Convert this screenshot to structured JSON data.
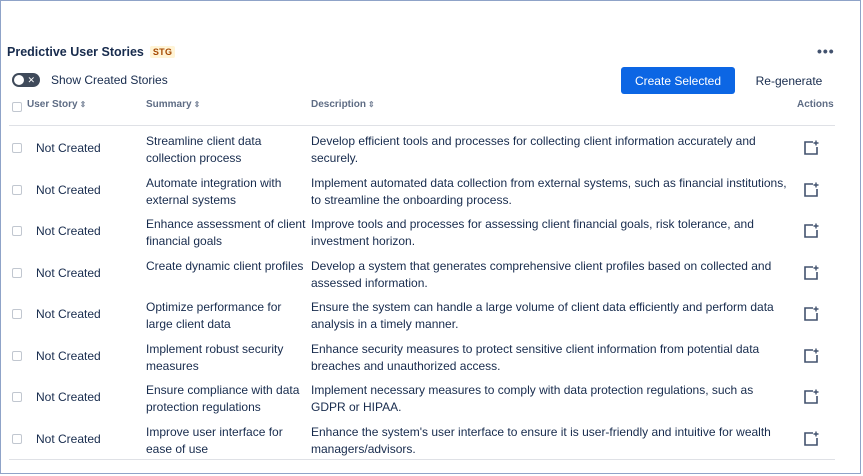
{
  "header": {
    "title": "Predictive User Stories",
    "badge": "STG",
    "more_icon": "more-horizontal-icon"
  },
  "toolbar": {
    "toggle_label": "Show Created Stories",
    "create_label": "Create Selected",
    "regenerate_label": "Re-generate",
    "toggle_on": false,
    "accent_color": "#0c66e4"
  },
  "table": {
    "headers": {
      "user_story": "User Story",
      "summary": "Summary",
      "description": "Description",
      "actions": "Actions"
    },
    "rows": [
      {
        "status": "Not Created",
        "summary": "Streamline client data collection process",
        "description": "Develop efficient tools and processes for collecting client information accurately and securely."
      },
      {
        "status": "Not Created",
        "summary": "Automate integration with external systems",
        "description": "Implement automated data collection from external systems, such as financial institutions, to streamline the onboarding process."
      },
      {
        "status": "Not Created",
        "summary": "Enhance assessment of client financial goals",
        "description": "Improve tools and processes for assessing client financial goals, risk tolerance, and investment horizon."
      },
      {
        "status": "Not Created",
        "summary": "Create dynamic client profiles",
        "description": "Develop a system that generates comprehensive client profiles based on collected and assessed information."
      },
      {
        "status": "Not Created",
        "summary": "Optimize performance for large client data",
        "description": "Ensure the system can handle a large volume of client data efficiently and perform data analysis in a timely manner."
      },
      {
        "status": "Not Created",
        "summary": "Implement robust security measures",
        "description": "Enhance security measures to protect sensitive client information from potential data breaches and unauthorized access."
      },
      {
        "status": "Not Created",
        "summary": "Ensure compliance with data protection regulations",
        "description": "Implement necessary measures to comply with data protection regulations, such as GDPR or HIPAA."
      },
      {
        "status": "Not Created",
        "summary": "Improve user interface for ease of use",
        "description": "Enhance the system's user interface to ensure it is user-friendly and intuitive for wealth managers/advisors."
      }
    ],
    "action_icon": "create-issue-icon"
  }
}
